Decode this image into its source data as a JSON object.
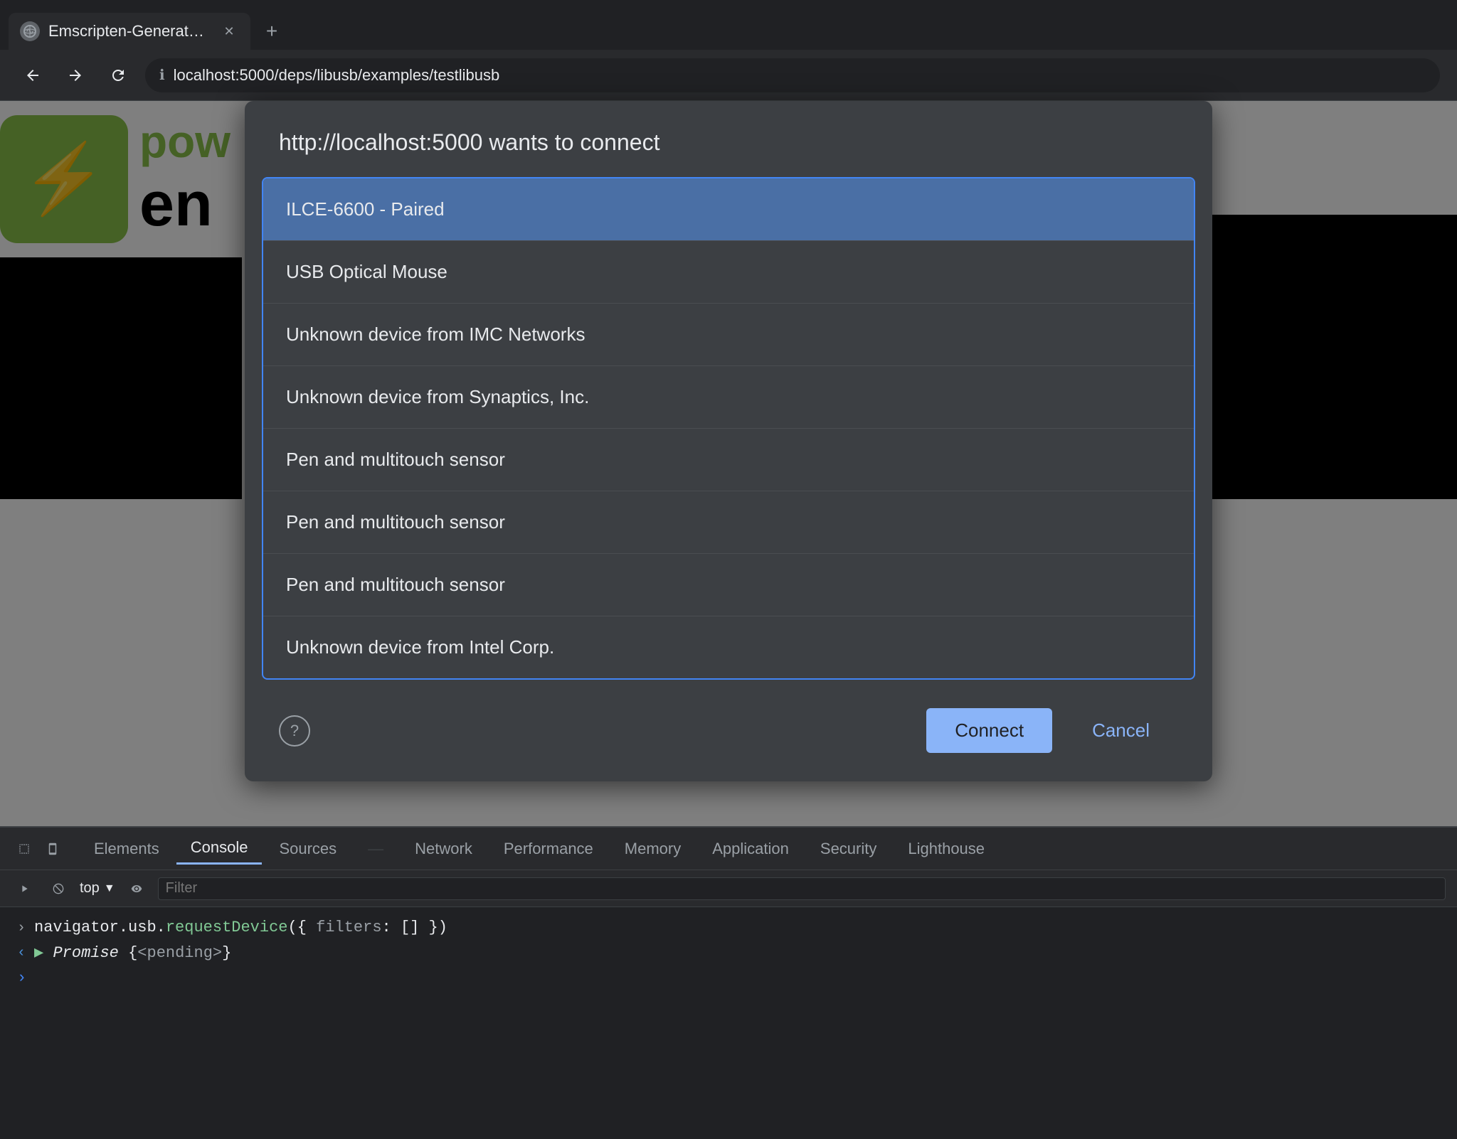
{
  "browser": {
    "tab_title": "Emscripten-Generated Code",
    "url": "localhost:5000/deps/libusb/examples/testlibusb",
    "new_tab_label": "+"
  },
  "dialog": {
    "title": "http://localhost:5000 wants to connect",
    "devices": [
      {
        "id": "device-0",
        "name": "ILCE-6600 - Paired",
        "selected": true
      },
      {
        "id": "device-1",
        "name": "USB Optical Mouse",
        "selected": false
      },
      {
        "id": "device-2",
        "name": "Unknown device from IMC Networks",
        "selected": false
      },
      {
        "id": "device-3",
        "name": "Unknown device from Synaptics, Inc.",
        "selected": false
      },
      {
        "id": "device-4",
        "name": "Pen and multitouch sensor",
        "selected": false
      },
      {
        "id": "device-5",
        "name": "Pen and multitouch sensor",
        "selected": false
      },
      {
        "id": "device-6",
        "name": "Pen and multitouch sensor",
        "selected": false
      },
      {
        "id": "device-7",
        "name": "Unknown device from Intel Corp.",
        "selected": false
      }
    ],
    "connect_label": "Connect",
    "cancel_label": "Cancel"
  },
  "devtools": {
    "tabs": [
      "Elements",
      "Console",
      "Sources",
      "Network",
      "Performance",
      "Memory",
      "Application",
      "Security",
      "Lighthouse"
    ],
    "active_tab": "Console",
    "context": "top",
    "filter_placeholder": "Filter",
    "console_lines": [
      {
        "type": "input",
        "text": "navigator.usb.requestDevice({ filters: [] })"
      },
      {
        "type": "output",
        "text": "Promise {<pending>}"
      }
    ]
  },
  "page": {
    "logo_text_top": "pow",
    "logo_text_bottom": "en"
  }
}
